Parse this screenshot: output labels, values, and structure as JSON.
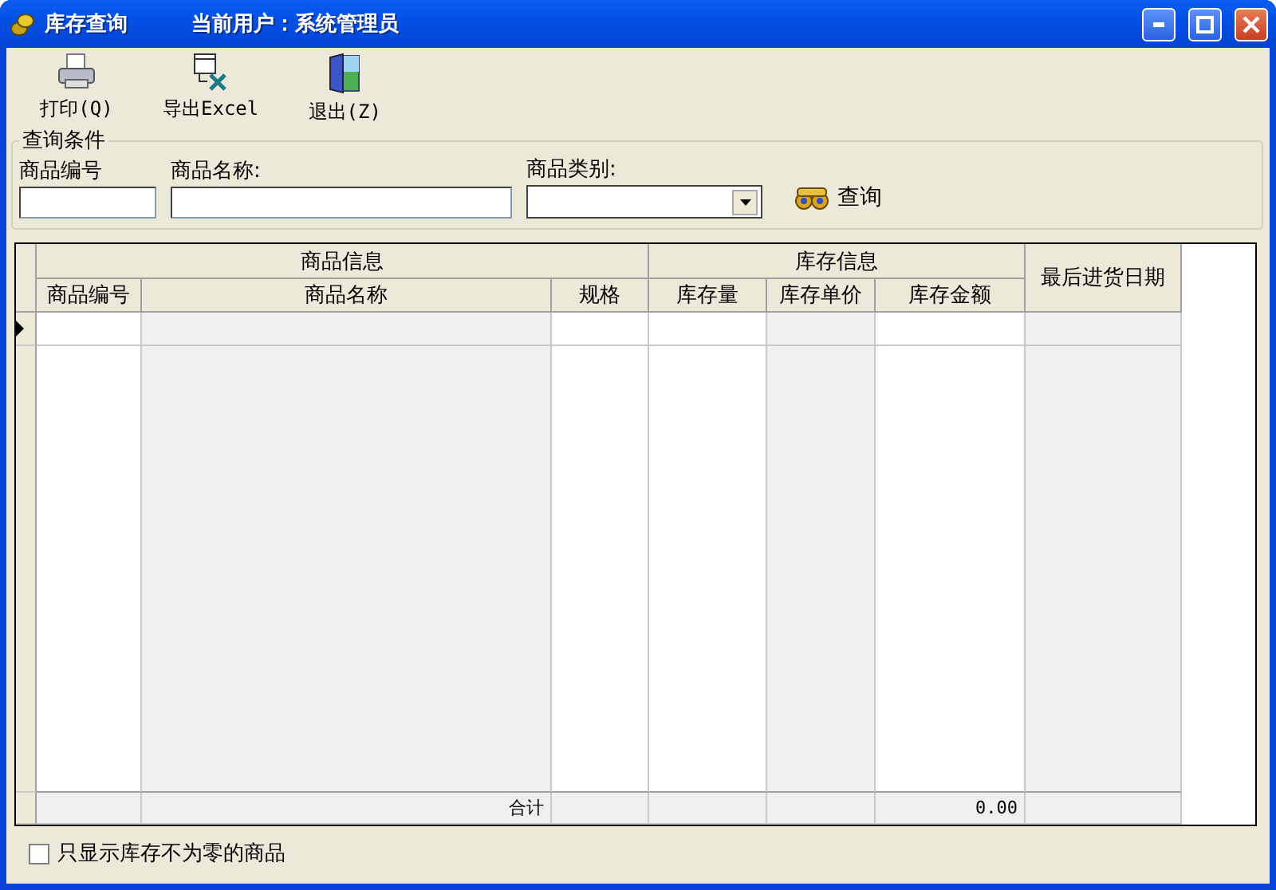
{
  "window": {
    "title": "库存查询",
    "current_user": "当前用户：系统管理员"
  },
  "toolbar": [
    {
      "kind": "print",
      "label": "打印(Q)"
    },
    {
      "kind": "export",
      "label": "导出Excel"
    },
    {
      "kind": "exit",
      "label": "退出(Z)"
    }
  ],
  "query": {
    "title": "查询条件",
    "fields": [
      {
        "kind": "text",
        "label": "商品编号"
      },
      {
        "kind": "text",
        "label": "商品名称:"
      },
      {
        "kind": "dropdown",
        "label": "商品类别:"
      }
    ],
    "search_button": "查询"
  },
  "table": {
    "groups": [
      {
        "label": "商品信息",
        "columns": [
          {
            "label": "商品编号",
            "shaded": false
          },
          {
            "label": "商品名称",
            "shaded": true
          },
          {
            "label": "规格",
            "shaded": false
          }
        ]
      },
      {
        "label": "库存信息",
        "columns": [
          {
            "label": "库存量",
            "shaded": false
          },
          {
            "label": "库存单价",
            "shaded": true
          },
          {
            "label": "库存金额",
            "shaded": false
          }
        ]
      }
    ],
    "last_column": {
      "label": "最后进货日期",
      "shaded": true
    },
    "rows": [
      {
        "current": true
      }
    ],
    "total": {
      "label": "合计",
      "amount": "0.00"
    }
  },
  "filter_checkbox": {
    "label": "只显示库存不为零的商品",
    "checked": false
  }
}
